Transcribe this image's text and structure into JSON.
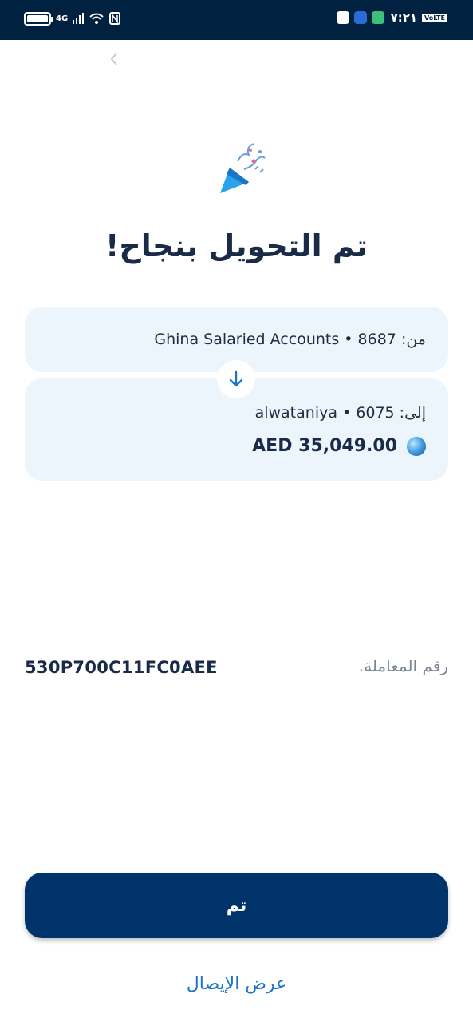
{
  "status_bar": {
    "network": "4G",
    "time": "٧:٢١",
    "volte": "VoLTE"
  },
  "header": {
    "back_icon": "chevron-left-icon"
  },
  "title": "تم التحويل بنجاح!",
  "transfer": {
    "from_text": "من: 8687 • Ghina Salaried Accounts",
    "to_text": "إلى: 6075 • alwataniya",
    "amount": "AED 35,049.00",
    "arrow_icon": "arrow-down-icon",
    "currency_icon": "globe-icon"
  },
  "transaction": {
    "label": "رقم المعاملة.",
    "value": "530P700C11FC0AEE"
  },
  "actions": {
    "done_label": "تم",
    "receipt_label": "عرض الإيصال"
  },
  "colors": {
    "status_bar": "#00213f",
    "card_bg": "#edf5fc",
    "primary": "#00336a",
    "link": "#1a74c8"
  }
}
